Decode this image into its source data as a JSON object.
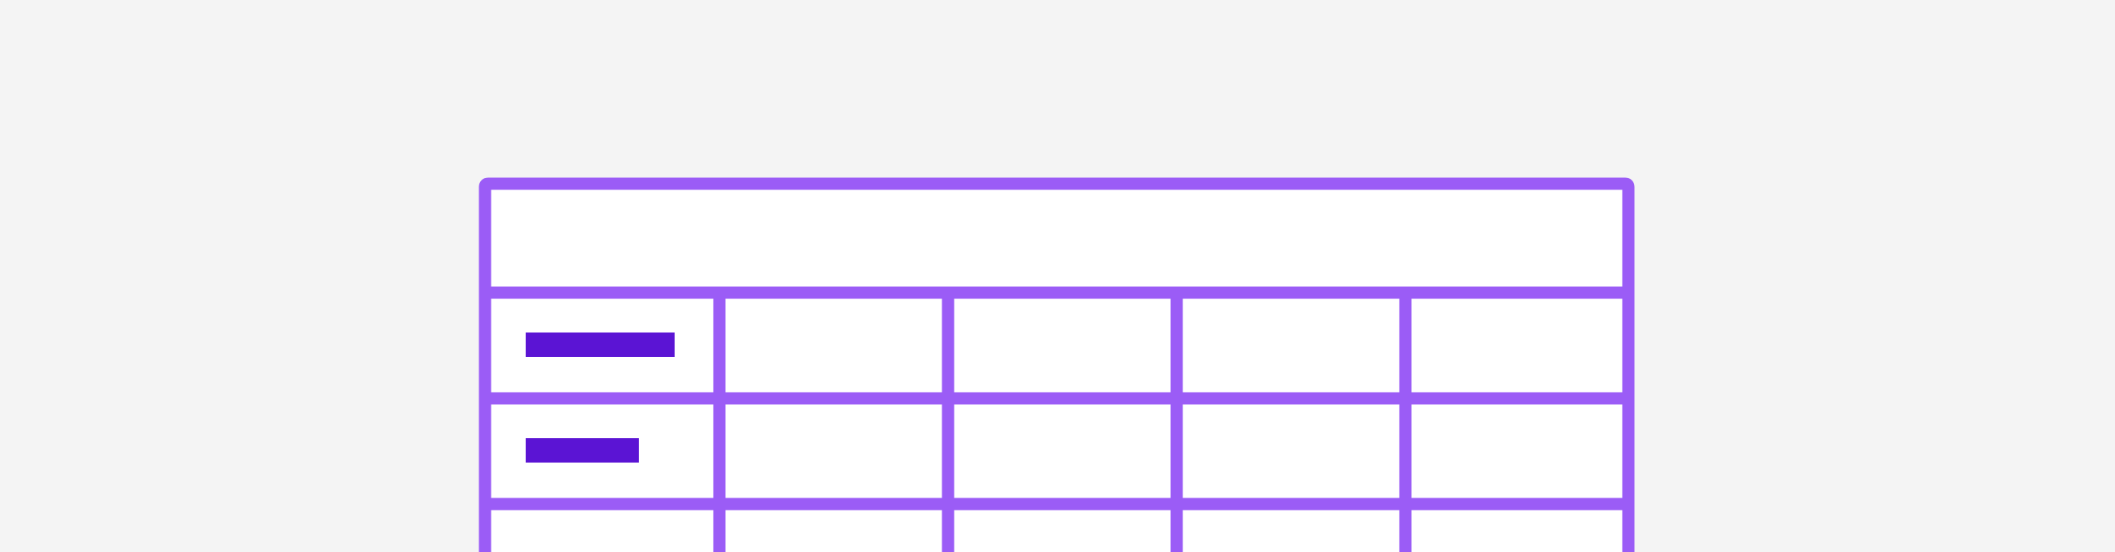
{
  "colors": {
    "background": "#f4f4f4",
    "table_fill": "#ffffff",
    "grid_line": "#9b5cf6",
    "placeholder_bar": "#5b14d4"
  },
  "table": {
    "header_row": {
      "text": ""
    },
    "columns": 5,
    "rows": [
      {
        "cells": [
          "",
          "",
          "",
          "",
          ""
        ],
        "placeholder_fraction": 1.0
      },
      {
        "cells": [
          "",
          "",
          "",
          "",
          ""
        ],
        "placeholder_fraction": 0.76
      },
      {
        "cells": [
          "",
          "",
          "",
          "",
          ""
        ],
        "placeholder_fraction": 0
      }
    ]
  }
}
